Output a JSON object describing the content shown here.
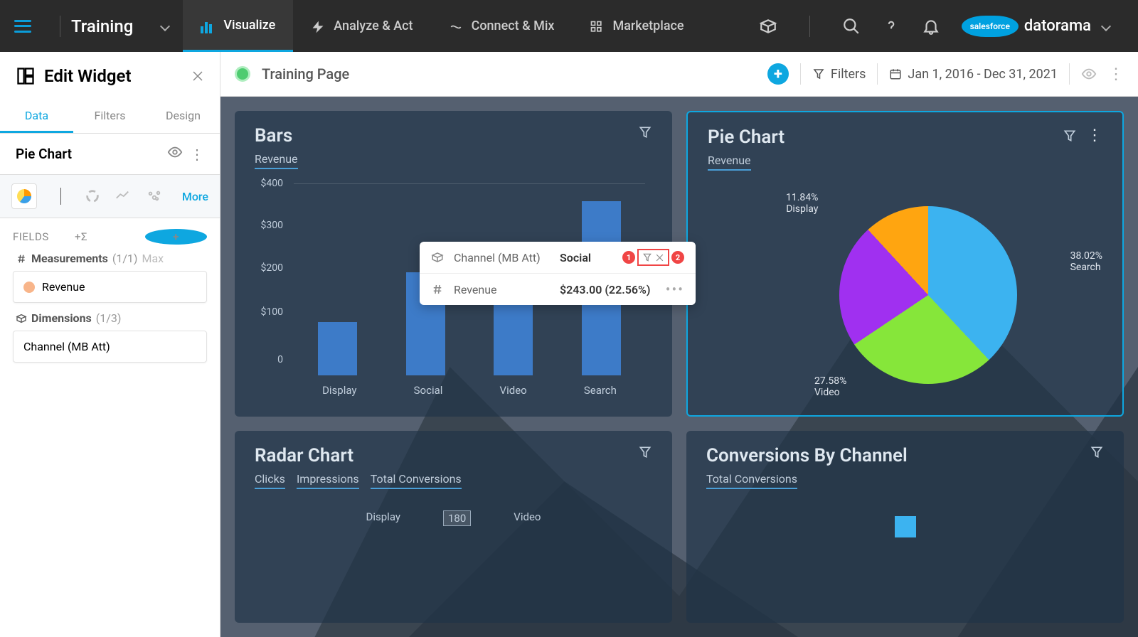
{
  "topnav": {
    "app_title": "Training",
    "tabs": [
      {
        "label": "Visualize",
        "active": true
      },
      {
        "label": "Analyze & Act",
        "active": false
      },
      {
        "label": "Connect & Mix",
        "active": false
      },
      {
        "label": "Marketplace",
        "active": false
      }
    ],
    "brand_primary": "salesforce",
    "brand_secondary": "datorama"
  },
  "sidebar": {
    "title": "Edit Widget",
    "tabs": [
      "Data",
      "Filters",
      "Design"
    ],
    "active_tab": "Data",
    "chart_name": "Pie Chart",
    "more_label": "More",
    "fields_label": "FIELDS",
    "measurements": {
      "label": "Measurements",
      "count": "(1/1)",
      "limit": "Max",
      "items": [
        "Revenue"
      ]
    },
    "dimensions": {
      "label": "Dimensions",
      "count": "(1/3)",
      "items": [
        "Channel (MB Att)"
      ]
    }
  },
  "page_header": {
    "title": "Training Page",
    "filters_label": "Filters",
    "date_range": "Jan 1, 2016 - Dec 31, 2021"
  },
  "widgets": {
    "bars": {
      "title": "Bars",
      "subtitle": "Revenue"
    },
    "pie": {
      "title": "Pie Chart",
      "subtitle": "Revenue"
    },
    "radar": {
      "title": "Radar Chart",
      "subtitles": [
        "Clicks",
        "Impressions",
        "Total Conversions"
      ],
      "axis_labels": [
        "Display",
        "Video"
      ],
      "tick": "180"
    },
    "conversions": {
      "title": "Conversions By Channel",
      "subtitles": [
        "Total Conversions"
      ]
    }
  },
  "tooltip": {
    "dim_label": "Channel (MB Att)",
    "dim_value": "Social",
    "meas_label": "Revenue",
    "meas_value": "$243.00 (22.56%)",
    "badge1": "1",
    "badge2": "2"
  },
  "chart_data": [
    {
      "type": "bar",
      "title": "Bars",
      "ylabel": "Revenue",
      "categories": [
        "Display",
        "Social",
        "Video",
        "Search"
      ],
      "values": [
        127,
        243,
        195,
        410
      ],
      "y_ticks": [
        "$400",
        "$300",
        "$200",
        "$100",
        "0"
      ],
      "ylim": [
        0,
        450
      ]
    },
    {
      "type": "pie",
      "title": "Pie Chart",
      "series": [
        {
          "name": "Search",
          "value": 38.02,
          "label": "38.02%\nSearch",
          "color": "#3cb3f0"
        },
        {
          "name": "Video",
          "value": 27.58,
          "label": "27.58%\nVideo",
          "color": "#86e63a"
        },
        {
          "name": "Social",
          "value": 22.56,
          "label": "22.56%\nSocial",
          "color": "#a030f0"
        },
        {
          "name": "Display",
          "value": 11.84,
          "label": "11.84%\nDisplay",
          "color": "#ffa510"
        }
      ]
    }
  ]
}
